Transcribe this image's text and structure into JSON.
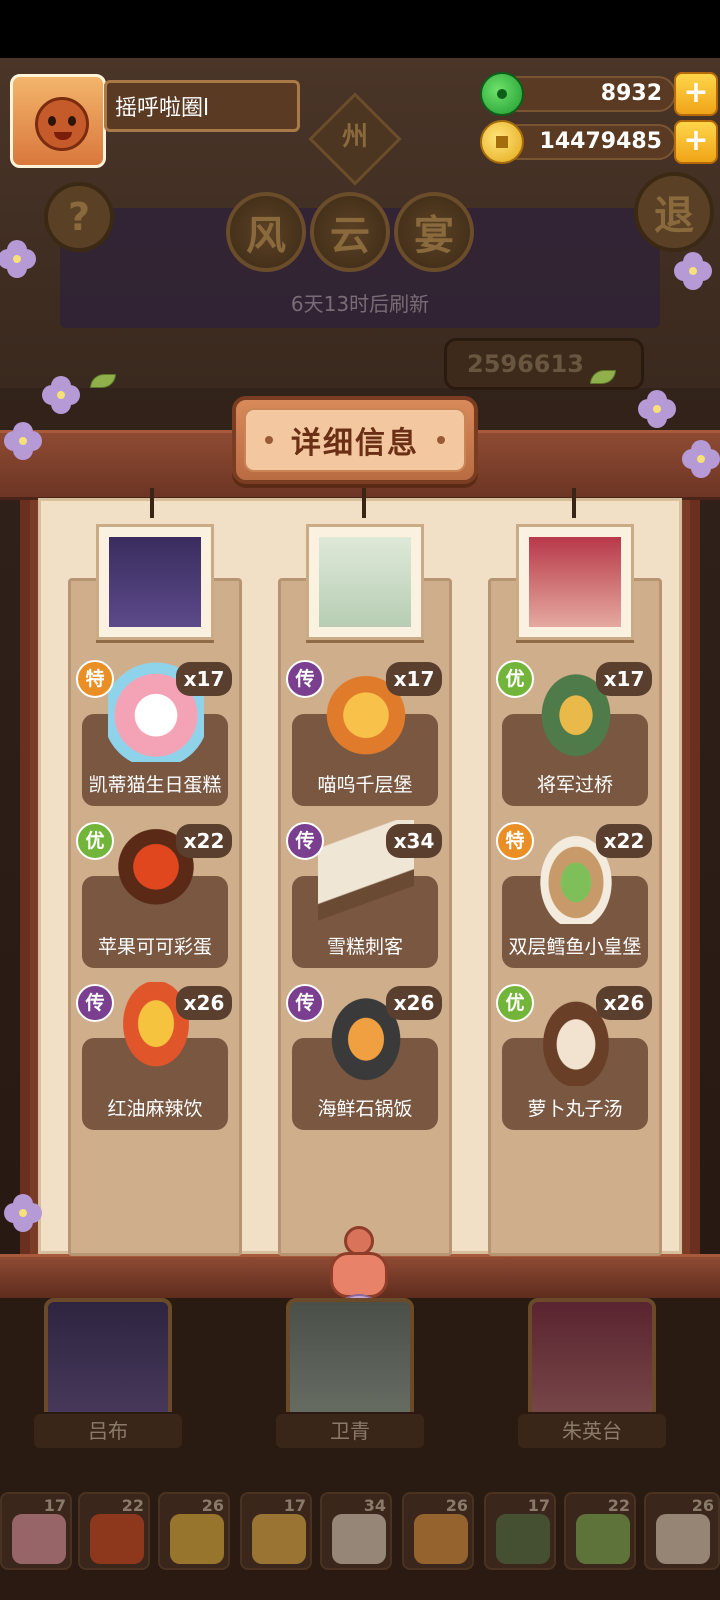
{
  "header": {
    "player_name": "摇呼啦圈l",
    "jade": "8932",
    "coins": "14479485",
    "plus_label": "+",
    "help_label": "?",
    "exit_label": "退",
    "zhou_label": "州",
    "title_chars": [
      "风",
      "云",
      "宴"
    ],
    "refresh": "6天13时后刷新",
    "score": "2596613"
  },
  "panel": {
    "title": "详细信息",
    "columns": [
      {
        "dishes": [
          {
            "rarity": "特",
            "count": "x17",
            "name": "凯蒂猫生日蛋糕"
          },
          {
            "rarity": "优",
            "count": "x22",
            "name": "苹果可可彩蛋"
          },
          {
            "rarity": "传",
            "count": "x26",
            "name": "红油麻辣饮"
          }
        ]
      },
      {
        "dishes": [
          {
            "rarity": "传",
            "count": "x17",
            "name": "喵呜千层堡"
          },
          {
            "rarity": "传",
            "count": "x34",
            "name": "雪糕刺客"
          },
          {
            "rarity": "传",
            "count": "x26",
            "name": "海鲜石锅饭"
          }
        ]
      },
      {
        "dishes": [
          {
            "rarity": "优",
            "count": "x17",
            "name": "将军过桥"
          },
          {
            "rarity": "特",
            "count": "x22",
            "name": "双层鳕鱼小皇堡"
          },
          {
            "rarity": "优",
            "count": "x26",
            "name": "萝卜丸子汤"
          }
        ]
      }
    ]
  },
  "chefs": [
    {
      "name": "吕布"
    },
    {
      "name": "卫青"
    },
    {
      "name": "朱英台"
    }
  ],
  "tray": [
    "17",
    "22",
    "26",
    "17",
    "34",
    "26",
    "17",
    "22",
    "26"
  ],
  "colors": {
    "rarity_te": "#e98f25",
    "rarity_chuan": "#7b3f8f",
    "rarity_you": "#73b53a",
    "panel_red": "#7a3b27",
    "paper": "#f1dfc6"
  }
}
